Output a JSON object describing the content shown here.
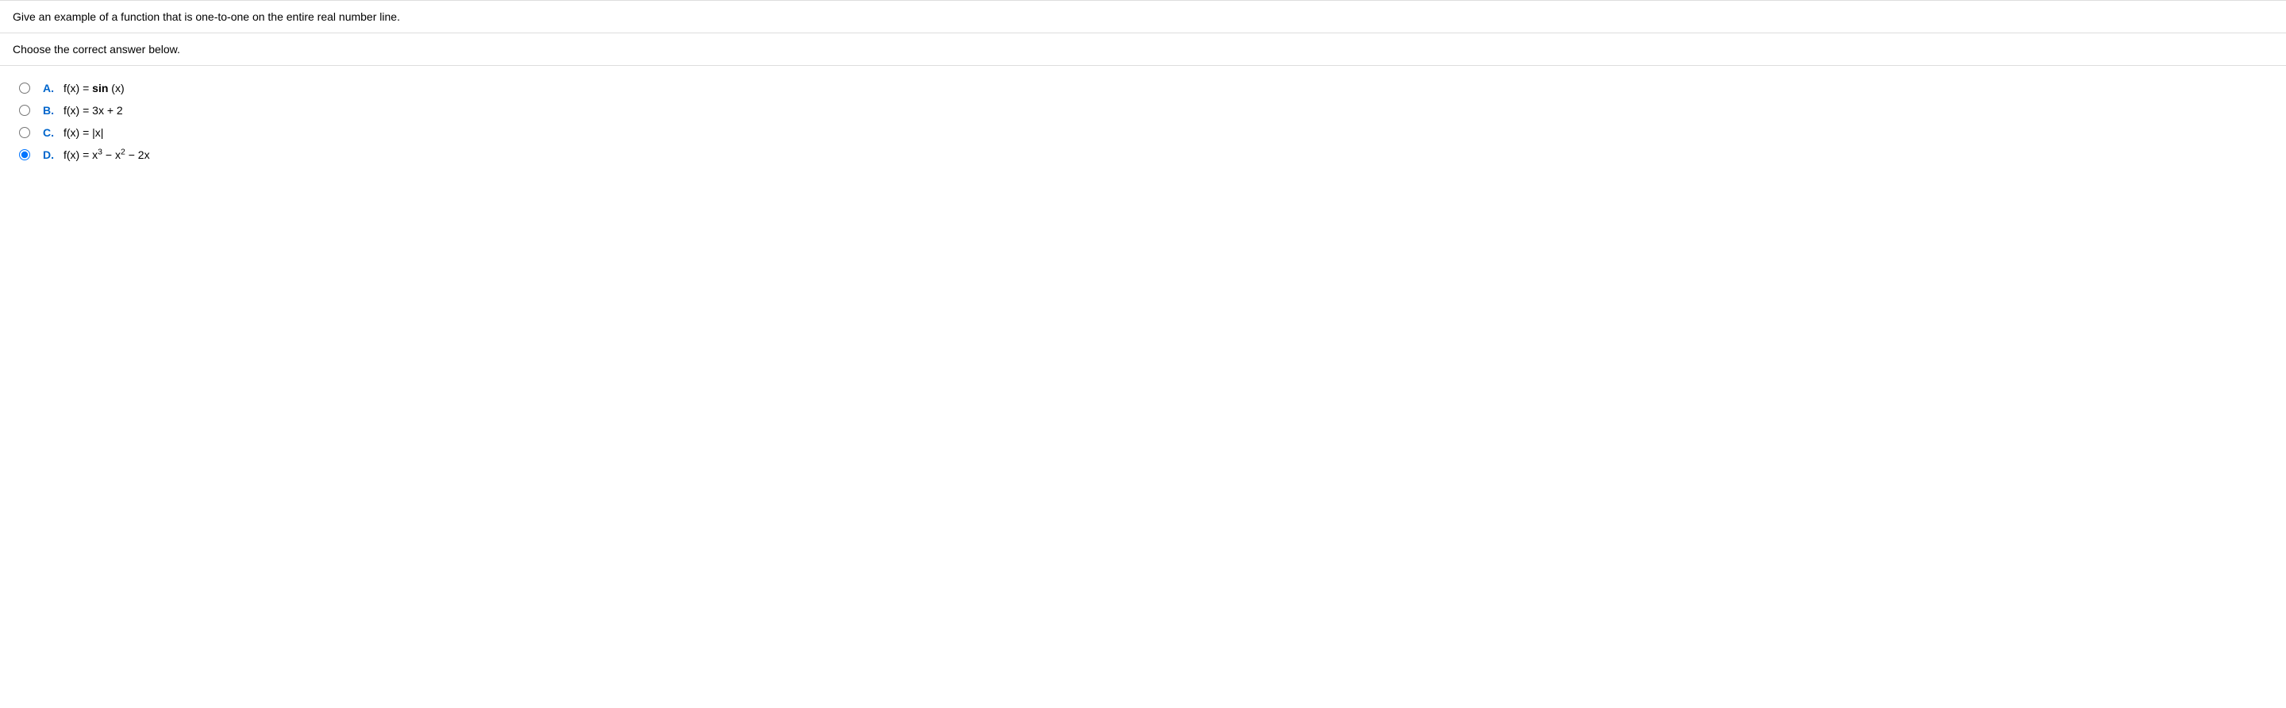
{
  "question": {
    "prompt": "Give an example of a function that is one-to-one on the entire real number line.",
    "instruction": "Choose the correct answer below."
  },
  "options": {
    "a": {
      "letter": "A.",
      "text_prefix": "f(x) = ",
      "text_bold": "sin",
      "text_suffix": " (x)"
    },
    "b": {
      "letter": "B.",
      "text": "f(x) = 3x + 2"
    },
    "c": {
      "letter": "C.",
      "text": "f(x) = |x|"
    },
    "d": {
      "letter": "D.",
      "text_part1": "f(x) = x",
      "sup1": "3",
      "text_part2": " − x",
      "sup2": "2",
      "text_part3": " − 2x"
    }
  },
  "selected": "d"
}
